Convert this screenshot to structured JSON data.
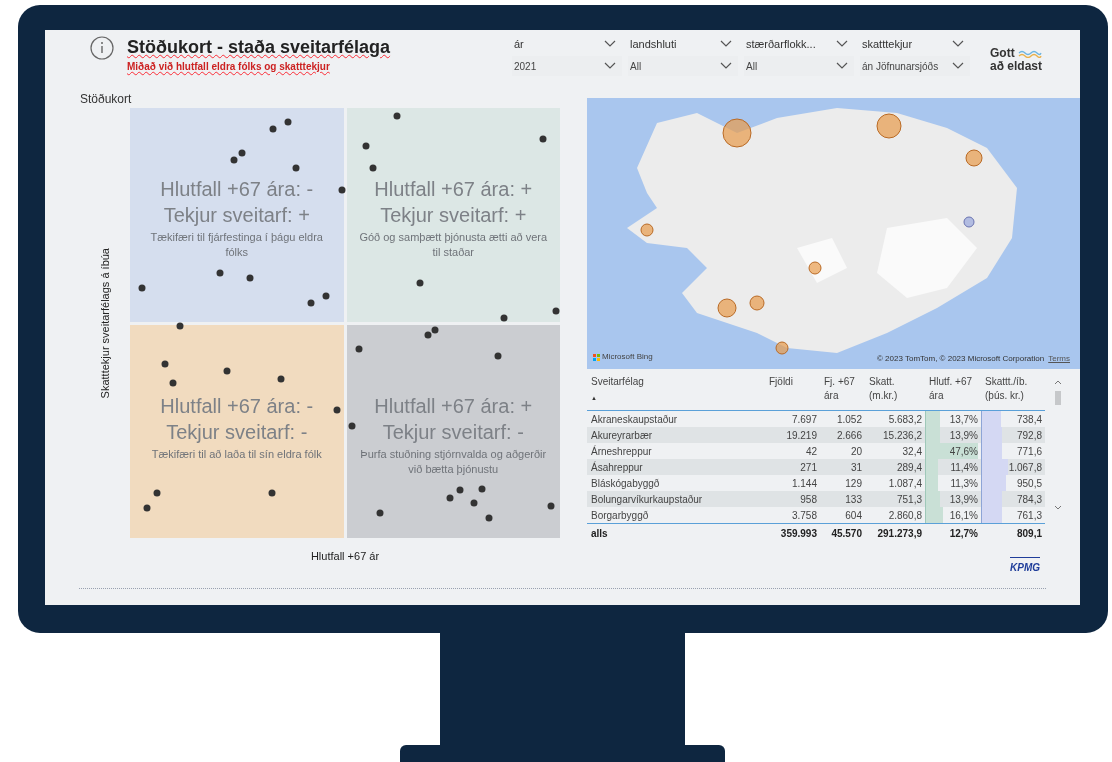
{
  "header": {
    "title": "Stöðukort - staða sveitarfélaga",
    "subtitle": "Miðað við hlutfall eldra fólks og skatttekjur"
  },
  "slicers": [
    {
      "label": "ár",
      "value": "2021"
    },
    {
      "label": "landshluti",
      "value": "All"
    },
    {
      "label": "stærðarflokk...",
      "value": "All"
    },
    {
      "label": "skatttekjur",
      "value": "án Jöfnunarsjóðs"
    }
  ],
  "logo": {
    "line_1": "Gott",
    "line_2": "að eldast"
  },
  "quadrant_chart": {
    "title": "Stöðukort",
    "ylabel": "Skatttekjur sveitarfélags á íbúa",
    "xlabel": "Hlutfall +67 ár",
    "quadrants": [
      {
        "title_1": "Hlutfall +67 ára: -",
        "title_2": "Tekjur sveitarf: +",
        "description": "Tækifæri til fjárfestinga í þágu eldra fólks",
        "color": "#d5deee"
      },
      {
        "title_1": "Hlutfall +67 ára: +",
        "title_2": "Tekjur sveitarf: +",
        "description": "Góð og samþætt þjónusta ætti að vera til staðar",
        "color": "#dce7e5"
      },
      {
        "title_1": "Hlutfall +67 ára: -",
        "title_2": "Tekjur sveitarf: -",
        "description": "Tækifæri til að laða til sín eldra fólk",
        "color": "#f1dbbf"
      },
      {
        "title_1": "Hlutfall +67 ára: +",
        "title_2": "Tekjur sveitarf: -",
        "description": "Þurfa stuðning stjórnvalda og aðgerðir við bætta þjónustu",
        "color": "#cbcdd1"
      }
    ]
  },
  "map": {
    "kind": "picture",
    "provider": "Microsoft Bing",
    "attribution": "© 2023 TomTom, © 2023 Microsoft Corporation",
    "terms": "Terms"
  },
  "table": {
    "columns": [
      "Sveitarfélag",
      "Fjöldi",
      "Fj. +67 ára",
      "Skatt. (m.kr.)",
      "Hlutf. +67 ára",
      "Skattt./íb. (þús. kr.)"
    ],
    "sort_mark": "▲",
    "rows": [
      {
        "cells": [
          "Akraneskaupstaður",
          "7.697",
          "1.052",
          "5.683,2",
          "13,7%",
          "738,4"
        ],
        "share_bar": {
          "level": 0.25
        },
        "income_bar": {
          "level": 0.3
        }
      },
      {
        "cells": [
          "Akureyrarbær",
          "19.219",
          "2.666",
          "15.236,2",
          "13,9%",
          "792,8"
        ],
        "share_bar": {
          "level": 0.26
        },
        "income_bar": {
          "level": 0.32
        }
      },
      {
        "cells": [
          "Árneshreppur",
          "42",
          "20",
          "32,4",
          "47,6%",
          "771,6"
        ],
        "share_bar": {
          "level": 0.95
        },
        "income_bar": {
          "level": 0.31
        }
      },
      {
        "cells": [
          "Ásahreppur",
          "271",
          "31",
          "289,4",
          "11,4%",
          "1.067,8"
        ],
        "share_bar": {
          "level": 0.21
        },
        "income_bar": {
          "level": 0.42
        }
      },
      {
        "cells": [
          "Bláskógabyggð",
          "1.144",
          "129",
          "1.087,4",
          "11,3%",
          "950,5"
        ],
        "share_bar": {
          "level": 0.21
        },
        "income_bar": {
          "level": 0.38
        }
      },
      {
        "cells": [
          "Bolungarvíkurkaupstaður",
          "958",
          "133",
          "751,3",
          "13,9%",
          "784,3"
        ],
        "share_bar": {
          "level": 0.26
        },
        "income_bar": {
          "level": 0.32
        }
      },
      {
        "cells": [
          "Borgarbyggð",
          "3.758",
          "604",
          "2.860,8",
          "16,1%",
          "761,3"
        ],
        "share_bar": {
          "level": 0.31
        },
        "income_bar": {
          "level": 0.31
        }
      }
    ],
    "total": [
      "alls",
      "359.993",
      "45.570",
      "291.273,9",
      "12,7%",
      "809,1"
    ]
  },
  "footer_logo": "KPMG"
}
